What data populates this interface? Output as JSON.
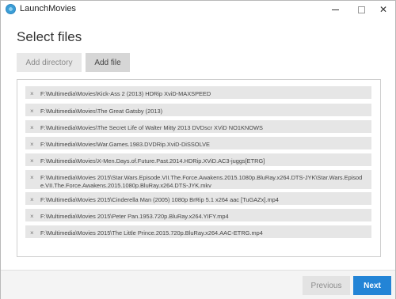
{
  "window": {
    "title": "LaunchMovies",
    "controls": {
      "minimize": "minimize-icon",
      "maximize": "maximize-icon",
      "close": "✕"
    }
  },
  "page": {
    "heading": "Select files"
  },
  "toolbar": {
    "add_directory_label": "Add directory",
    "add_file_label": "Add file"
  },
  "files": [
    {
      "path": "F:\\Multimedia\\Movies\\Kick-Ass 2 (2013) HDRip XviD-MAXSPEED"
    },
    {
      "path": "F:\\Multimedia\\Movies\\The Great Gatsby (2013)"
    },
    {
      "path": "F:\\Multimedia\\Movies\\The Secret Life of Walter Mitty 2013 DVDscr XViD NO1KNOWS"
    },
    {
      "path": "F:\\Multimedia\\Movies\\War.Games.1983.DVDRip.XviD-DiSSOLVE"
    },
    {
      "path": "F:\\Multimedia\\Movies\\X-Men.Days.of.Future.Past.2014.HDRip.XViD.AC3-juggs[ETRG]"
    },
    {
      "path": "F:\\Multimedia\\Movies 2015\\Star.Wars.Episode.VII.The.Force.Awakens.2015.1080p.BluRay.x264.DTS-JYK\\Star.Wars.Episode.VII.The.Force.Awakens.2015.1080p.BluRay.x264.DTS-JYK.mkv"
    },
    {
      "path": "F:\\Multimedia\\Movies 2015\\Cinderella Man (2005) 1080p BrRip 5.1 x264 aac [TuGAZx].mp4"
    },
    {
      "path": "F:\\Multimedia\\Movies 2015\\Peter Pan.1953.720p.BluRay.x264.YIFY.mp4"
    },
    {
      "path": "F:\\Multimedia\\Movies 2015\\The Little Prince.2015.720p.BluRay.x264.AAC-ETRG.mp4"
    }
  ],
  "remove_glyph": "×",
  "footer": {
    "previous_label": "Previous",
    "next_label": "Next"
  },
  "colors": {
    "accent": "#2384d6",
    "item_background": "#e6e6e6"
  }
}
